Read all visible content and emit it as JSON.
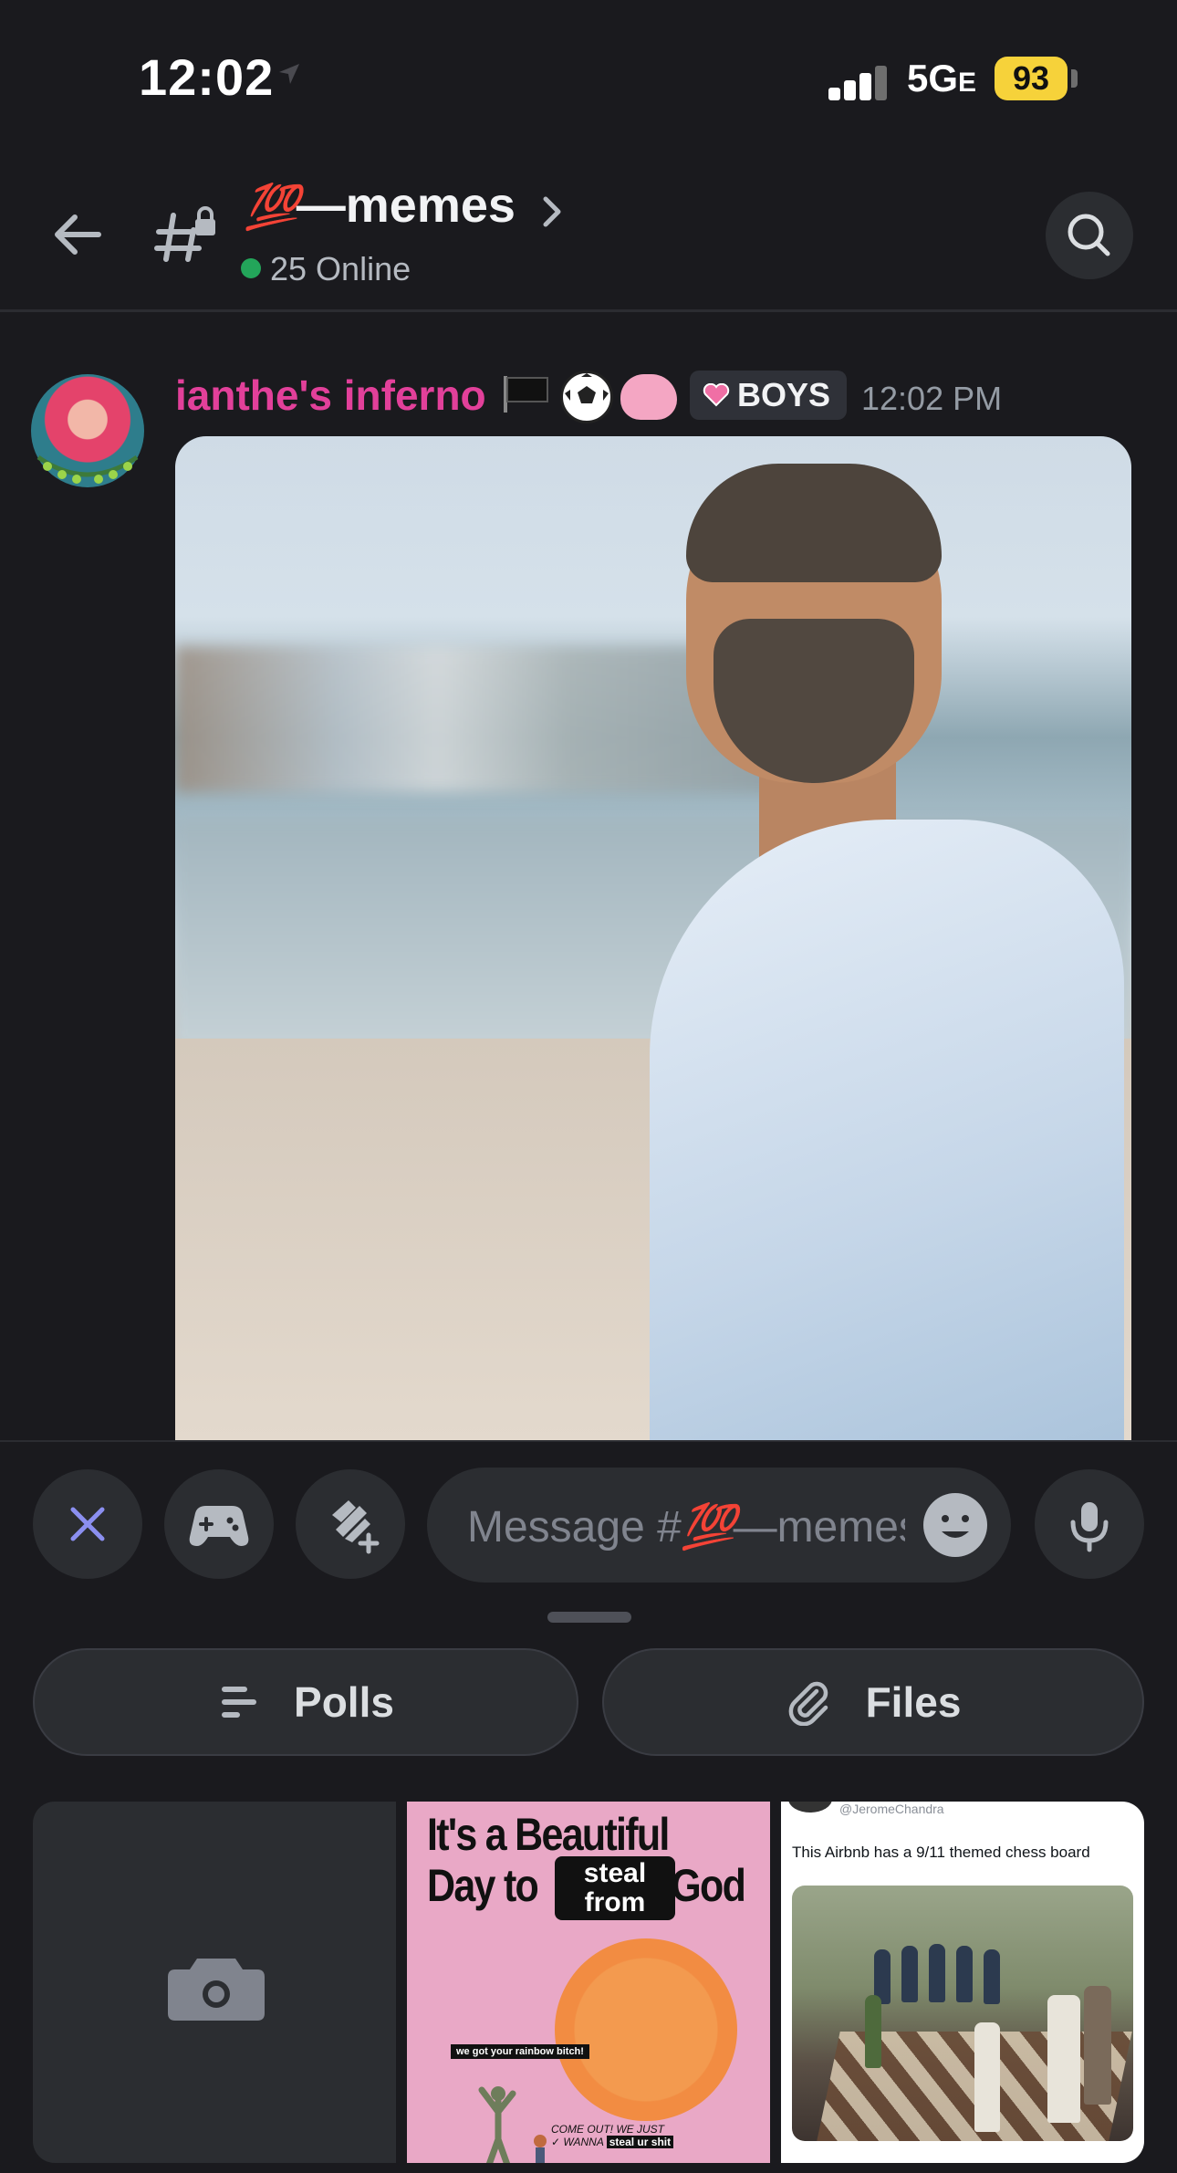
{
  "status_bar": {
    "time": "12:02",
    "network": "5G",
    "network_suffix": "E",
    "battery": "93"
  },
  "header": {
    "channel_emoji": "💯",
    "channel_name": "—memes",
    "online_count": "25 Online"
  },
  "message": {
    "author": "ianthe's inferno",
    "role": "BOYS",
    "time": "12:02 PM"
  },
  "composer": {
    "placeholder_prefix": "Message #",
    "placeholder_emoji": "💯",
    "placeholder_suffix": "—memes"
  },
  "drawer": {
    "polls_label": "Polls",
    "files_label": "Files",
    "gallery": {
      "meme": {
        "line1": "It's a Beautiful",
        "line2_left": "Day to",
        "steal": "steal",
        "from": "from",
        "line2_right": "God",
        "caption": "we got your rainbow bitch!",
        "small_line1": "COME OUT! WE JUST",
        "small_line2": "WANNA",
        "small_black": "steal ur shit"
      },
      "tweet": {
        "handle": "@JeromeChandra",
        "text": "This Airbnb has a 9/11 themed chess board"
      }
    }
  },
  "colors": {
    "background": "#1a1a1e",
    "author": "#e2409a",
    "online": "#23a55a",
    "battery": "#f6d23a",
    "accent_icon": "#8b8ff0"
  }
}
